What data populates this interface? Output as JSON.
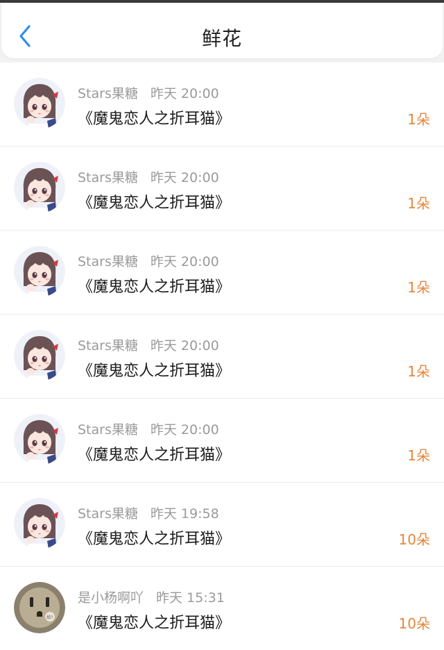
{
  "header": {
    "title": "鲜花",
    "back_icon": "chevron-left-icon",
    "accent": "#2d8cf0"
  },
  "colors": {
    "count": "#e8853a",
    "meta": "#9a9a9a"
  },
  "items": [
    {
      "user": "Stars果糖",
      "time": "昨天 20:00",
      "work": "《魔鬼恋人之折耳猫》",
      "count": "1朵",
      "avatar": "anime-girl-avatar"
    },
    {
      "user": "Stars果糖",
      "time": "昨天 20:00",
      "work": "《魔鬼恋人之折耳猫》",
      "count": "1朵",
      "avatar": "anime-girl-avatar"
    },
    {
      "user": "Stars果糖",
      "time": "昨天 20:00",
      "work": "《魔鬼恋人之折耳猫》",
      "count": "1朵",
      "avatar": "anime-girl-avatar"
    },
    {
      "user": "Stars果糖",
      "time": "昨天 20:00",
      "work": "《魔鬼恋人之折耳猫》",
      "count": "1朵",
      "avatar": "anime-girl-avatar"
    },
    {
      "user": "Stars果糖",
      "time": "昨天 20:00",
      "work": "《魔鬼恋人之折耳猫》",
      "count": "1朵",
      "avatar": "anime-girl-avatar"
    },
    {
      "user": "Stars果糖",
      "time": "昨天 19:58",
      "work": "《魔鬼恋人之折耳猫》",
      "count": "10朵",
      "avatar": "anime-girl-avatar"
    },
    {
      "user": "是小杨啊吖",
      "time": "昨天 15:31",
      "work": "《魔鬼恋人之折耳猫》",
      "count": "10朵",
      "avatar": "power-outlet-avatar"
    }
  ]
}
